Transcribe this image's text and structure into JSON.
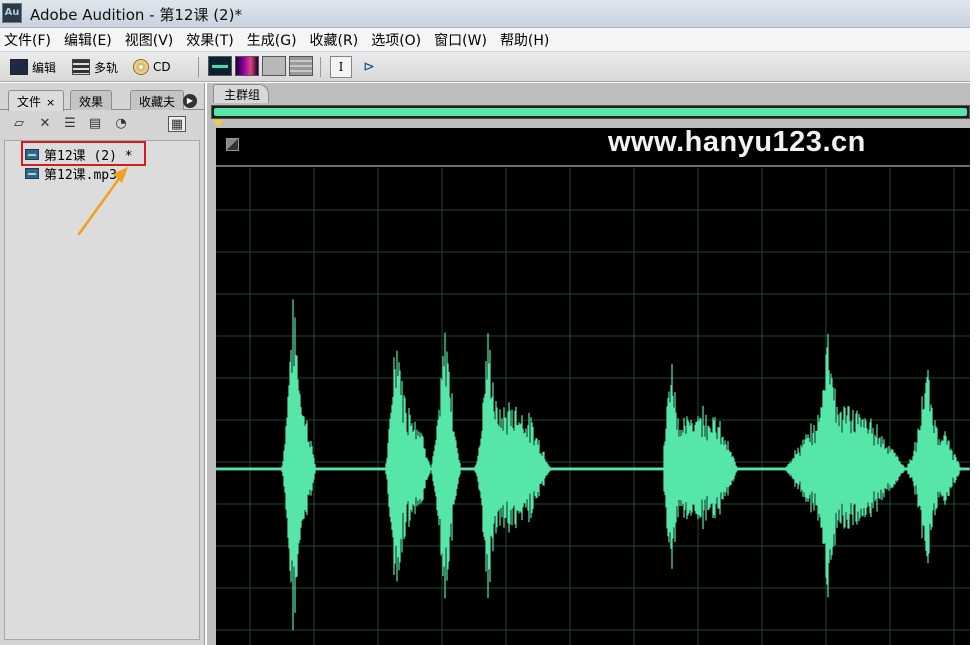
{
  "window": {
    "app_icon": "Au",
    "title": "Adobe Audition - 第12课 (2)*"
  },
  "menu": [
    "文件(F)",
    "编辑(E)",
    "视图(V)",
    "效果(T)",
    "生成(G)",
    "收藏(R)",
    "选项(O)",
    "窗口(W)",
    "帮助(H)"
  ],
  "toolbar": {
    "edit_label": "编辑",
    "multitrack_label": "多轨",
    "cd_label": "CD",
    "cursor_tool_glyph": "I",
    "select_tool_glyph": "⊳"
  },
  "left_panel": {
    "tabs": [
      "文件",
      "效果",
      "收藏夫"
    ],
    "close_glyph": "×",
    "files": [
      "第12课 (2) *",
      "第12课.mp3"
    ]
  },
  "main_panel": {
    "tab": "主群组"
  },
  "watermark": "www.hanyu123.cn",
  "colors": {
    "waveform": "#55e6a8",
    "highlight": "#cc1f1f",
    "arrow": "#f0a020",
    "background": "#000000"
  }
}
